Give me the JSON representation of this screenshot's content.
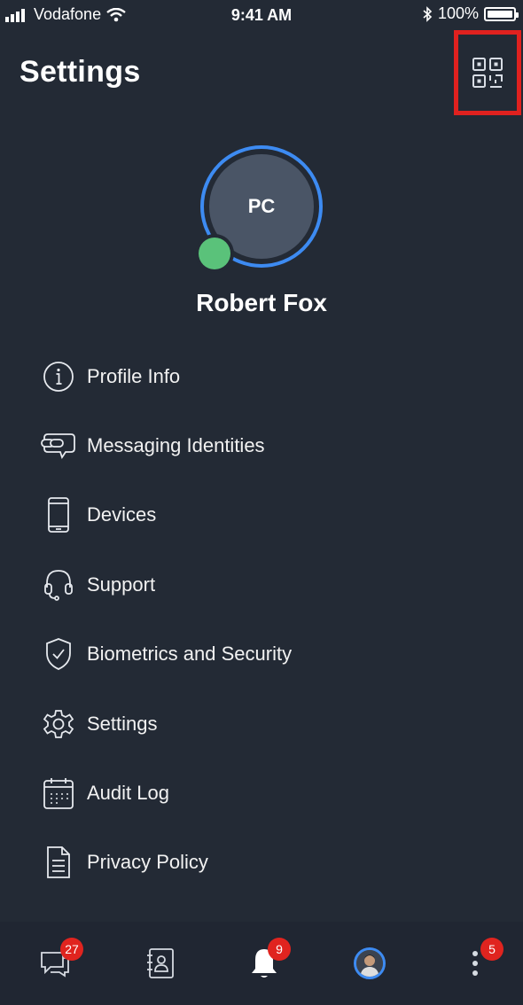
{
  "status_bar": {
    "carrier": "Vodafone",
    "time": "9:41 AM",
    "battery": "100%"
  },
  "header": {
    "title": "Settings",
    "qr_icon": "qr-code-icon",
    "highlight_color": "#e0211f"
  },
  "profile": {
    "initials": "PC",
    "name": "Robert Fox",
    "ring_color": "#3d8bf2",
    "presence_color": "#5ac27a"
  },
  "menu": {
    "items": [
      {
        "label": "Profile Info",
        "icon": "info-icon"
      },
      {
        "label": "Messaging Identities",
        "icon": "chat-link-icon"
      },
      {
        "label": "Devices",
        "icon": "phone-icon"
      },
      {
        "label": "Support",
        "icon": "headset-icon"
      },
      {
        "label": "Biometrics and Security",
        "icon": "shield-check-icon"
      },
      {
        "label": "Settings",
        "icon": "gear-icon"
      },
      {
        "label": "Audit Log",
        "icon": "calendar-icon"
      },
      {
        "label": "Privacy Policy",
        "icon": "document-icon"
      }
    ]
  },
  "tab_bar": {
    "chats_badge": "27",
    "notifications_badge": "9",
    "more_badge": "5",
    "badge_color": "#e0241f"
  }
}
